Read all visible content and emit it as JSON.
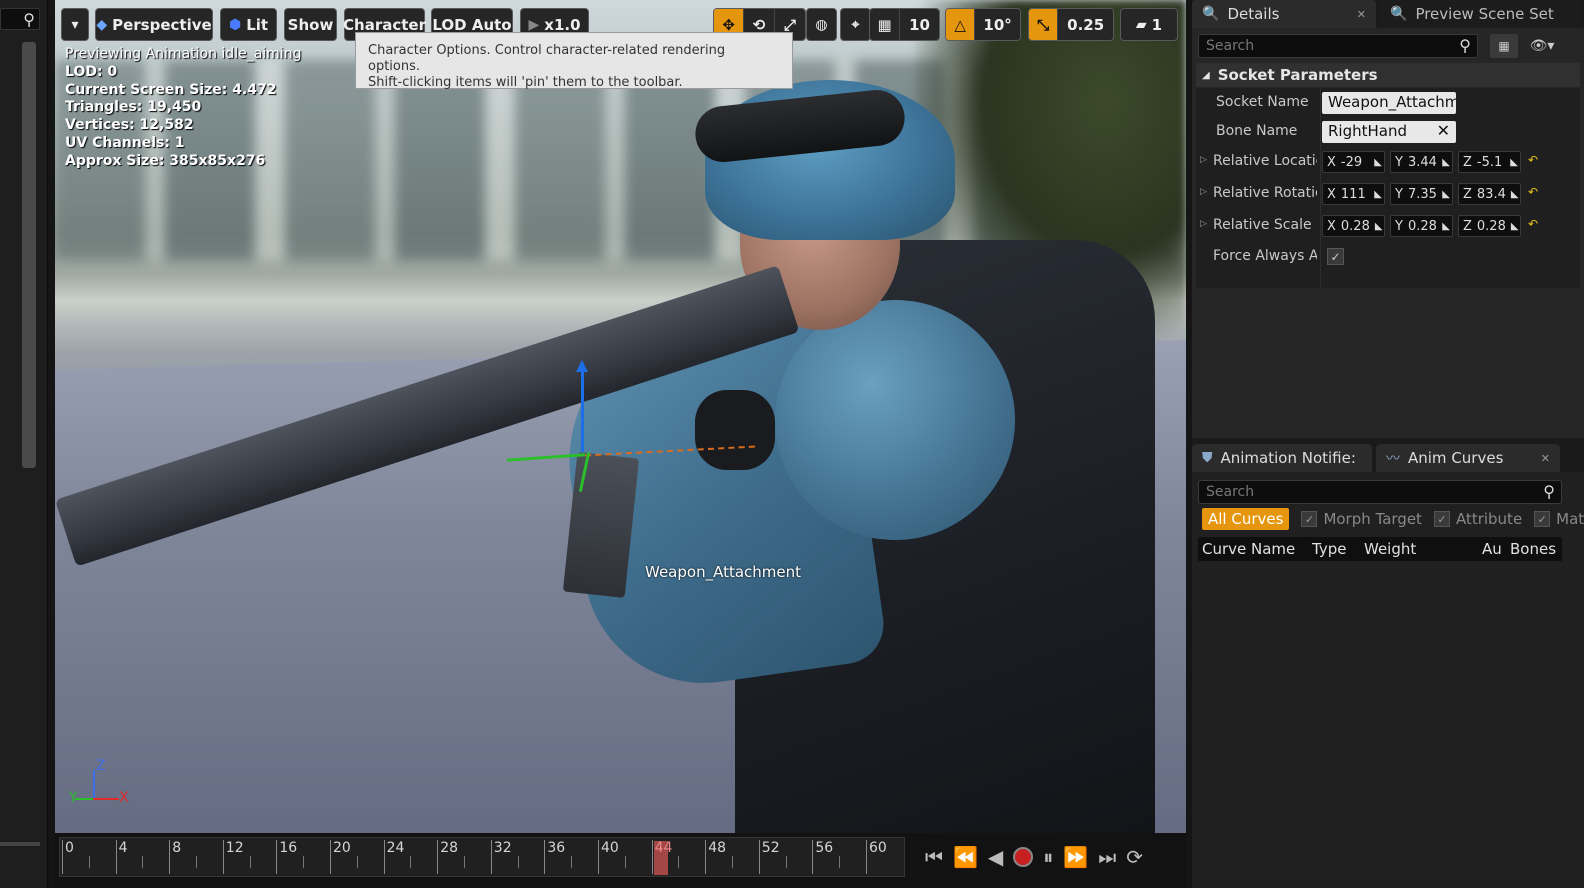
{
  "viewport_toolbar": {
    "perspective": "Perspective",
    "lit": "Lit",
    "show": "Show",
    "character": "Character",
    "lod": "LOD Auto",
    "speed": "x1.0",
    "grid_snap": "10",
    "rotation_snap": "10°",
    "scale_snap": "0.25",
    "camera_speed": "1"
  },
  "tooltip": {
    "line1": "Character Options. Control character-related rendering options.",
    "line2": "Shift-clicking items will 'pin' them to the toolbar."
  },
  "stats": {
    "preview": "Previewing Animation idle_aiming",
    "lod": "LOD: 0",
    "screen_size": "Current Screen Size: 4.472",
    "triangles": "Triangles: 19,450",
    "vertices": "Vertices: 12,582",
    "uv_channels": "UV Channels: 1",
    "approx_size": "Approx Size: 385x85x276"
  },
  "viewport": {
    "socket_label": "Weapon_Attachment",
    "axis": {
      "z": "Z",
      "x": "X",
      "y": "Y"
    }
  },
  "timeline": {
    "labels": [
      "0",
      "4",
      "8",
      "12",
      "16",
      "20",
      "24",
      "28",
      "32",
      "36",
      "40",
      "44",
      "48",
      "52",
      "56",
      "60"
    ],
    "current_frame": "44"
  },
  "details_panel": {
    "tab_details": "Details",
    "tab_preview": "Preview Scene Set",
    "search_placeholder": "Search",
    "section_title": "Socket Parameters",
    "socket_name_label": "Socket Name",
    "socket_name_value": "Weapon_Attachme",
    "bone_name_label": "Bone Name",
    "bone_name_value": "RightHand",
    "rel_location_label": "Relative Locatic",
    "rel_location": {
      "x": "-29",
      "y": "3.44",
      "z": "-5.1"
    },
    "rel_rotation_label": "Relative Rotatic",
    "rel_rotation": {
      "x": "111",
      "y": "7.35",
      "z": "83.4"
    },
    "rel_scale_label": "Relative Scale",
    "rel_scale": {
      "x": "0.28",
      "y": "0.28",
      "z": "0.28"
    },
    "force_always_label": "Force Always Ar"
  },
  "curves_panel": {
    "tab_notifies": "Animation Notifie:",
    "tab_curves": "Anim Curves",
    "search_placeholder": "Search",
    "filter_all": "All Curves",
    "filter_morph": "Morph Target",
    "filter_attribute": "Attribute",
    "filter_mat": "Mat",
    "columns": [
      "Curve Name",
      "Type",
      "Weight",
      "Au",
      "Bones"
    ]
  }
}
